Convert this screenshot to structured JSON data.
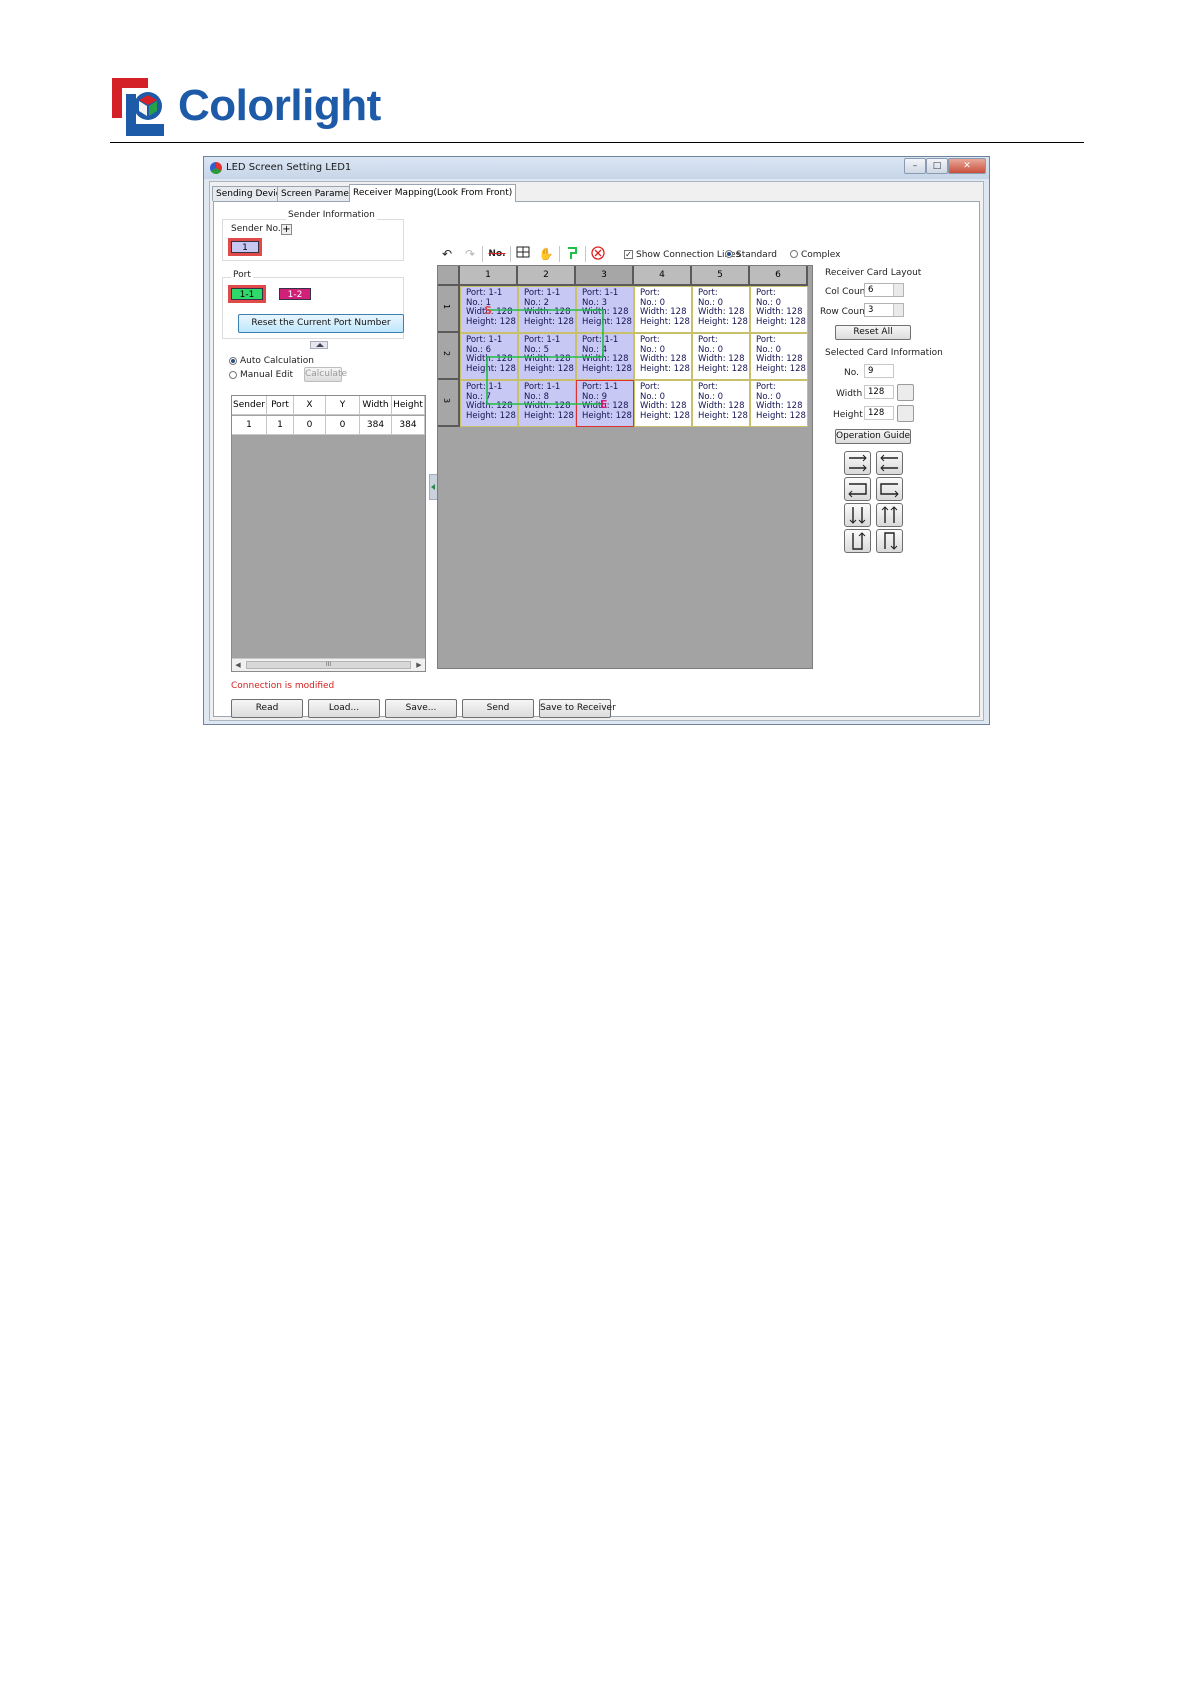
{
  "document": {
    "brand": "Colorlight"
  },
  "window": {
    "title": "LED Screen Setting LED1",
    "controls": {
      "minimize": "–",
      "maximize": "□",
      "close": "✕"
    }
  },
  "tabs": [
    "Sending Device",
    "Screen Parameters",
    "Receiver Mapping(Look From Front)"
  ],
  "sender": {
    "group_title": "Sender Information",
    "sender_no_label": "Sender No.",
    "add_label": "+",
    "sender_value": "1",
    "port_label": "Port",
    "ports": [
      "1-1",
      "1-2"
    ],
    "reset_port_label": "Reset the Current Port Number"
  },
  "calc": {
    "auto_label": "Auto Calculation",
    "manual_label": "Manual Edit",
    "calculate_label": "Calculate"
  },
  "port_table": {
    "headers": [
      "Sender",
      "Port",
      "X",
      "Y",
      "Width",
      "Height"
    ],
    "rows": [
      [
        "1",
        "1",
        "0",
        "0",
        "384",
        "384"
      ]
    ],
    "scroll_label": "III"
  },
  "status_text": "Connection is modified",
  "bottom_buttons": [
    "Read",
    "Load...",
    "Save...",
    "Send",
    "Save to Receiver"
  ],
  "toolbar": {
    "no_label": "No.",
    "show_connection_lines": "Show Connection Lines",
    "mode_standard": "Standard",
    "mode_complex": "Complex"
  },
  "grid": {
    "columns": [
      "1",
      "2",
      "3",
      "4",
      "5",
      "6"
    ],
    "rows": [
      "1",
      "2",
      "3"
    ],
    "cells": [
      [
        {
          "port": "Port: 1-1",
          "no": "No.: 1",
          "width": "Width: 128",
          "height": "Height: 128"
        },
        {
          "port": "Port: 1-1",
          "no": "No.: 2",
          "width": "Width: 128",
          "height": "Height: 128"
        },
        {
          "port": "Port: 1-1",
          "no": "No.: 3",
          "width": "Width: 128",
          "height": "Height: 128"
        },
        {
          "port": "Port:",
          "no": "No.: 0",
          "width": "Width: 128",
          "height": "Height: 128"
        },
        {
          "port": "Port:",
          "no": "No.: 0",
          "width": "Width: 128",
          "height": "Height: 128"
        },
        {
          "port": "Port:",
          "no": "No.: 0",
          "width": "Width: 128",
          "height": "Height: 128"
        }
      ],
      [
        {
          "port": "Port: 1-1",
          "no": "No.: 6",
          "width": "Width: 128",
          "height": "Height: 128"
        },
        {
          "port": "Port: 1-1",
          "no": "No.: 5",
          "width": "Width: 128",
          "height": "Height: 128"
        },
        {
          "port": "Port: 1-1",
          "no": "No.: 4",
          "width": "Width: 128",
          "height": "Height: 128"
        },
        {
          "port": "Port:",
          "no": "No.: 0",
          "width": "Width: 128",
          "height": "Height: 128"
        },
        {
          "port": "Port:",
          "no": "No.: 0",
          "width": "Width: 128",
          "height": "Height: 128"
        },
        {
          "port": "Port:",
          "no": "No.: 0",
          "width": "Width: 128",
          "height": "Height: 128"
        }
      ],
      [
        {
          "port": "Port: 1-1",
          "no": "No.: 7",
          "width": "Width: 128",
          "height": "Height: 128"
        },
        {
          "port": "Port: 1-1",
          "no": "No.: 8",
          "width": "Width: 128",
          "height": "Height: 128"
        },
        {
          "port": "Port: 1-1",
          "no": "No.: 9",
          "width": "Width: 128",
          "height": "Height: 128"
        },
        {
          "port": "Port:",
          "no": "No.: 0",
          "width": "Width: 128",
          "height": "Height: 128"
        },
        {
          "port": "Port:",
          "no": "No.: 0",
          "width": "Width: 128",
          "height": "Height: 128"
        },
        {
          "port": "Port:",
          "no": "No.: 0",
          "width": "Width: 128",
          "height": "Height: 128"
        }
      ]
    ],
    "start_marker": "S",
    "end_marker": "E"
  },
  "layout_panel": {
    "title": "Receiver Card Layout",
    "col_count_label": "Col Count",
    "col_count": "6",
    "row_count_label": "Row Count",
    "row_count": "3",
    "reset_all": "Reset All"
  },
  "selected_card": {
    "title": "Selected Card Information",
    "no_label": "No.",
    "no_value": "9",
    "width_label": "Width",
    "width_value": "128",
    "height_label": "Height",
    "height_value": "128"
  },
  "operation_guide_label": "Operation Guide",
  "colors": {
    "brand_blue": "#1d5aa8",
    "brand_red": "#d42027",
    "assigned_cell": "#c8c8f4",
    "connection_line": "#1fbf4a",
    "port_1_1": "#2fd86a",
    "port_1_2": "#d0207a",
    "status_red": "#d42020"
  }
}
